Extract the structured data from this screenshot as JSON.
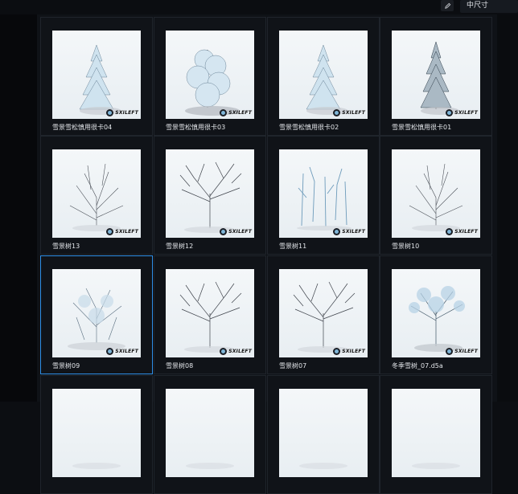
{
  "toolbar": {
    "edit_icon": "pencil-icon",
    "size_select_value": "中尺寸"
  },
  "brand": {
    "logo_text": "SXILEFT"
  },
  "assets": [
    {
      "label": "雪景雪松慎用很卡04",
      "kind": "snowy-pine"
    },
    {
      "label": "雪景雪松慎用很卡03",
      "kind": "snowy-pine-wide"
    },
    {
      "label": "雪景雪松慎用很卡02",
      "kind": "snowy-pine"
    },
    {
      "label": "雪景雪松慎用很卡01",
      "kind": "snowy-pine-dark"
    },
    {
      "label": "雪景树13",
      "kind": "bare-bush"
    },
    {
      "label": "雪景树12",
      "kind": "bare-tree"
    },
    {
      "label": "雪景树11",
      "kind": "bare-saplings"
    },
    {
      "label": "雪景树10",
      "kind": "bare-bush"
    },
    {
      "label": "雪景树09",
      "kind": "snowy-bush",
      "selected": true
    },
    {
      "label": "雪景树08",
      "kind": "bare-tree"
    },
    {
      "label": "雪景树07",
      "kind": "bare-tree"
    },
    {
      "label": "冬季雪树_07.d5a",
      "kind": "snowy-tree"
    },
    {
      "label": "",
      "kind": "partial"
    },
    {
      "label": "",
      "kind": "partial"
    },
    {
      "label": "",
      "kind": "partial"
    },
    {
      "label": "",
      "kind": "partial"
    }
  ]
}
